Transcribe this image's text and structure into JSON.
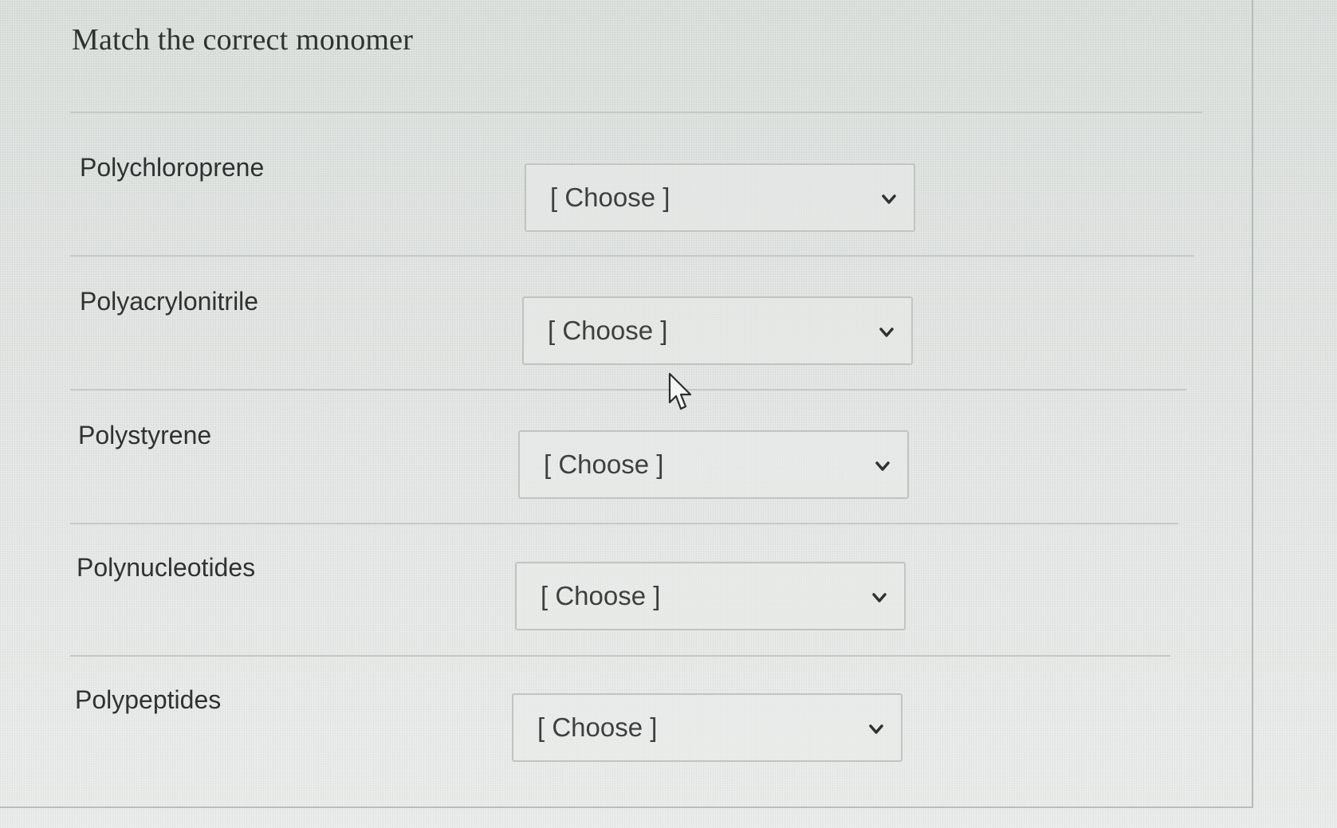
{
  "title": "Match the correct monomer",
  "rows": [
    {
      "label": "Polychloroprene",
      "select": {
        "value": "[ Choose ]"
      }
    },
    {
      "label": "Polyacrylonitrile",
      "select": {
        "value": "[ Choose ]"
      }
    },
    {
      "label": "Polystyrene",
      "select": {
        "value": "[ Choose ]"
      }
    },
    {
      "label": "Polynucleotides",
      "select": {
        "value": "[ Choose ]"
      }
    },
    {
      "label": "Polypeptides",
      "select": {
        "value": "[ Choose ]"
      }
    }
  ],
  "icons": {
    "dropdown": "chevron-down-icon",
    "cursor": "mouse-pointer-icon"
  }
}
